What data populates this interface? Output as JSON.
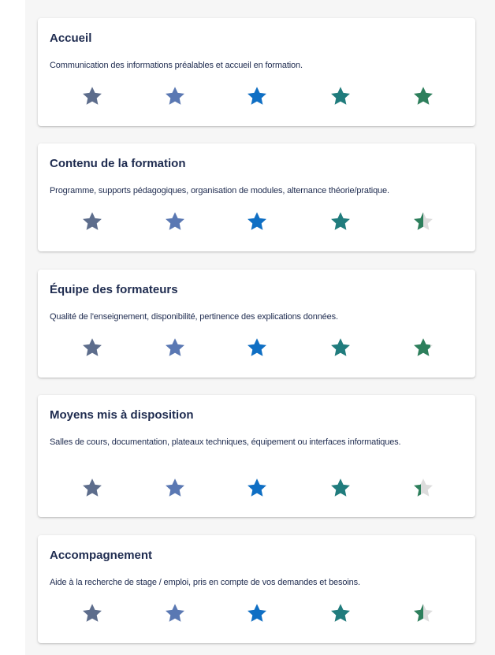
{
  "cards": [
    {
      "title": "Accueil",
      "description": "Communication des informations préalables et accueil en formation.",
      "rating": 5,
      "stars_aria": "5 sur 5"
    },
    {
      "title": "Contenu de la formation",
      "description": "Programme, supports pédagogiques, organisation de modules, alternance théorie/pratique.",
      "rating": 4.5,
      "stars_aria": "4,5 sur 5"
    },
    {
      "title": "Équipe des formateurs",
      "description": "Qualité de l'enseignement, disponibilité, pertinence des explications données.",
      "rating": 4.8,
      "stars_aria": "4,8 sur 5"
    },
    {
      "title": "Moyens mis à disposition",
      "description": "Salles de cours, documentation, plateaux techniques, équipement ou interfaces informatiques.",
      "rating": 4.4,
      "stars_aria": "4,4 sur 5"
    },
    {
      "title": "Accompagnement",
      "description": "Aide à la recherche de stage / emploi, pris en compte de vos demandes et besoins.",
      "rating": 4.5,
      "stars_aria": "4,5 sur 5"
    }
  ],
  "star_colors": [
    "#5d6d8c",
    "#5a78b3",
    "#0f6fc4",
    "#207c7d",
    "#2d7f5c"
  ],
  "empty_star_color": "#dcdcdc",
  "icons": {
    "star": "star-icon"
  }
}
